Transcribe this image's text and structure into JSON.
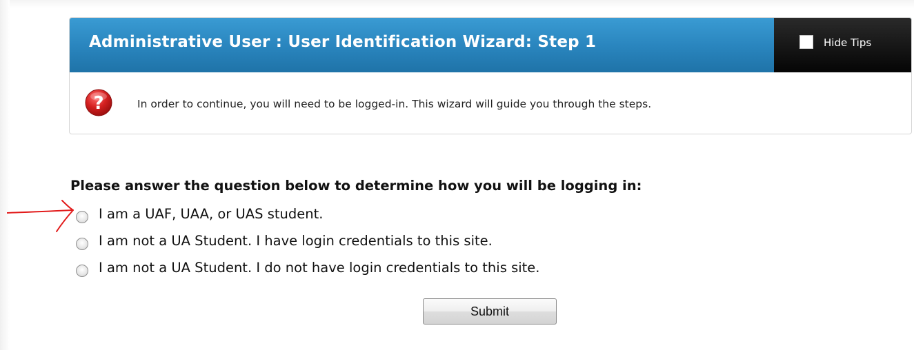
{
  "wizard": {
    "title": "Administrative User : User Identification Wizard: Step 1",
    "hide_tips_label": "Hide Tips",
    "tip_text": "In order to continue, you will need to be logged-in. This wizard will guide you through the steps."
  },
  "form": {
    "question": "Please answer the question below to determine how you will be logging in:",
    "options": [
      {
        "label": "I am a UAF, UAA, or UAS student.",
        "selected": false
      },
      {
        "label": "I am not a UA Student. I have login credentials to this site.",
        "selected": false
      },
      {
        "label": "I am not a UA Student. I do not have login credentials to this site.",
        "selected": false
      }
    ],
    "submit_label": "Submit"
  },
  "colors": {
    "header_blue": "#2a86bf",
    "tips_black": "#111111",
    "arrow_red": "#e21b1b",
    "help_red": "#d42020"
  },
  "icons": {
    "help": "question-mark-icon",
    "annotation": "red-arrow-annotation"
  }
}
